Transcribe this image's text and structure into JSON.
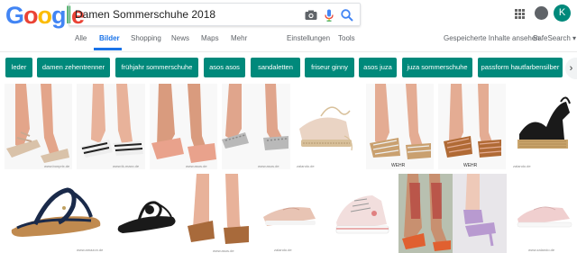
{
  "logo": [
    "G",
    "o",
    "o",
    "g",
    "l",
    "e"
  ],
  "logo_colors": [
    "#4285f4",
    "#ea4335",
    "#fbbc05",
    "#4285f4",
    "#34a853",
    "#ea4335"
  ],
  "search": {
    "query": "Damen Sommerschuhe 2018"
  },
  "account": {
    "initial": "K"
  },
  "nav": {
    "all": "Alle",
    "images": "Bilder",
    "shopping": "Shopping",
    "news": "News",
    "maps": "Maps",
    "more": "Mehr",
    "settings": "Einstellungen",
    "tools": "Tools",
    "saved": "Gespeicherte Inhalte ansehen",
    "safesearch": "SafeSearch ▾"
  },
  "chips": [
    "leder",
    "damen zehentrenner",
    "frühjahr sommerschuhe",
    "asos asos",
    "sandaletten",
    "friseur ginny",
    "asos juza",
    "juza sommerschuhe",
    "passform hautfarbensilber"
  ],
  "images": {
    "row1": [
      {
        "name": "strappy-nude-sandals",
        "source": "www.bonprix.de"
      },
      {
        "name": "stripe-flat-sandals",
        "source": "www.tk-maxx.de"
      },
      {
        "name": "pink-slide-sandals",
        "source": "www.asos.de"
      },
      {
        "name": "silver-woven-sandals",
        "source": "www.asos.de"
      },
      {
        "name": "espadrille-lace-up",
        "source": "zalando.de"
      },
      {
        "name": "caged-espadrille-sandals",
        "source": "WEHR"
      },
      {
        "name": "woven-leather-sandals",
        "source": "WEHR"
      },
      {
        "name": "black-espadrille-wedge",
        "source": "zalando.de"
      }
    ],
    "row2": [
      {
        "name": "navy-thong-sandals",
        "source": "www.amazon.de"
      },
      {
        "name": "black-bow-sandals",
        "source": ""
      },
      {
        "name": "tan-mule-sandals",
        "source": "www.asos.de"
      },
      {
        "name": "pink-slip-on-sneaker",
        "source": "zalando.de"
      },
      {
        "name": "canvas-sneaker",
        "source": ""
      },
      {
        "name": "street-style-sandals",
        "source": ""
      },
      {
        "name": "pink-sneaker",
        "source": "www.zalando.de"
      }
    ]
  }
}
